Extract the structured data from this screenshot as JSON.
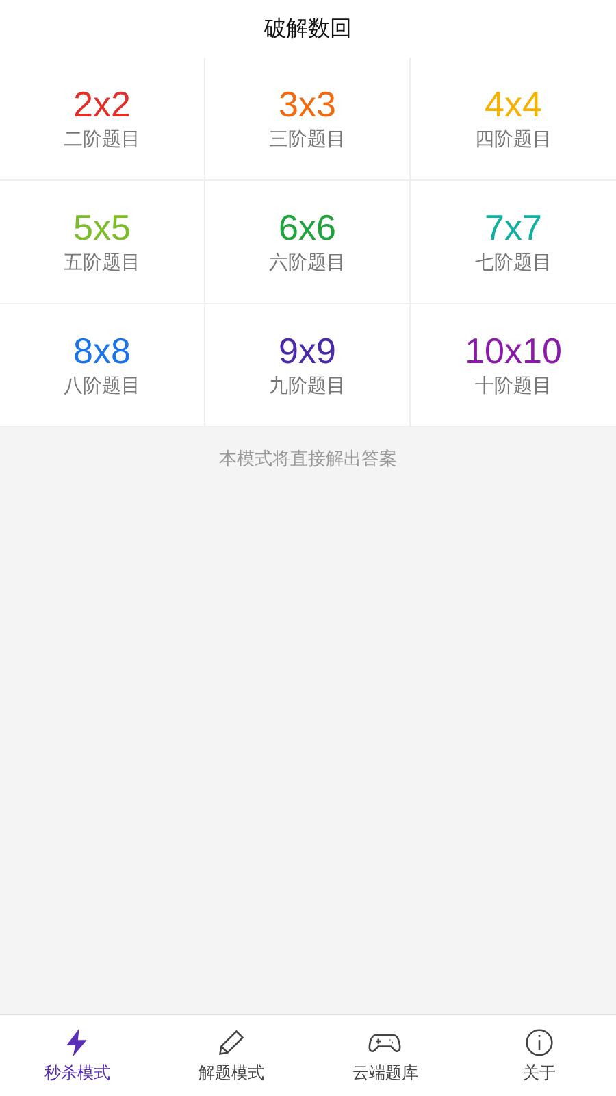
{
  "title": "破解数回",
  "levels": [
    {
      "size": "2x2",
      "label": "二阶题目",
      "color": "#e0302a"
    },
    {
      "size": "3x3",
      "label": "三阶题目",
      "color": "#f06a12"
    },
    {
      "size": "4x4",
      "label": "四阶题目",
      "color": "#f5b000"
    },
    {
      "size": "5x5",
      "label": "五阶题目",
      "color": "#7cbb2a"
    },
    {
      "size": "6x6",
      "label": "六阶题目",
      "color": "#20a33a"
    },
    {
      "size": "7x7",
      "label": "七阶题目",
      "color": "#12b0a0"
    },
    {
      "size": "8x8",
      "label": "八阶题目",
      "color": "#1a73e8"
    },
    {
      "size": "9x9",
      "label": "九阶题目",
      "color": "#4a2aa8"
    },
    {
      "size": "10x10",
      "label": "十阶题目",
      "color": "#8a1aa8"
    }
  ],
  "note": "本模式将直接解出答案",
  "tabs": [
    {
      "kind": "bolt",
      "label": "秒杀模式",
      "selected": true
    },
    {
      "kind": "pencil",
      "label": "解题模式",
      "selected": false
    },
    {
      "kind": "gamepad",
      "label": "云端题库",
      "selected": false
    },
    {
      "kind": "info",
      "label": "关于",
      "selected": false
    }
  ]
}
